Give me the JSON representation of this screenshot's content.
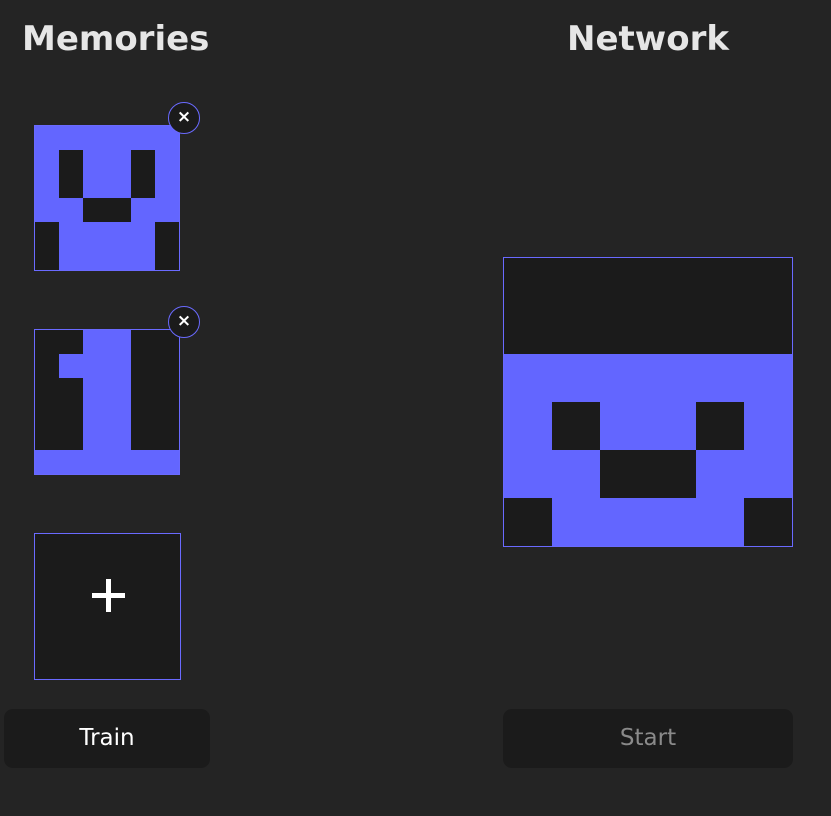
{
  "memories": {
    "title": "Memories",
    "items": [
      {
        "cells": [
          [
            1,
            1,
            1,
            1,
            1,
            1
          ],
          [
            1,
            0,
            1,
            1,
            0,
            1
          ],
          [
            1,
            0,
            1,
            1,
            0,
            1
          ],
          [
            1,
            1,
            0,
            0,
            1,
            1
          ],
          [
            0,
            1,
            1,
            1,
            1,
            0
          ],
          [
            0,
            1,
            1,
            1,
            1,
            0
          ]
        ],
        "remove_label": "×"
      },
      {
        "cells": [
          [
            0,
            0,
            1,
            1,
            0,
            0
          ],
          [
            0,
            1,
            1,
            1,
            0,
            0
          ],
          [
            0,
            0,
            1,
            1,
            0,
            0
          ],
          [
            0,
            0,
            1,
            1,
            0,
            0
          ],
          [
            0,
            0,
            1,
            1,
            0,
            0
          ],
          [
            1,
            1,
            1,
            1,
            1,
            1
          ]
        ],
        "remove_label": "×"
      }
    ],
    "add_icon": "plus-icon"
  },
  "network": {
    "title": "Network",
    "cells": [
      [
        0,
        0,
        0,
        0,
        0,
        0
      ],
      [
        0,
        0,
        0,
        0,
        0,
        0
      ],
      [
        1,
        1,
        1,
        1,
        1,
        1
      ],
      [
        1,
        0,
        1,
        1,
        0,
        1
      ],
      [
        1,
        1,
        0,
        0,
        1,
        1
      ],
      [
        0,
        1,
        1,
        1,
        1,
        0
      ]
    ]
  },
  "buttons": {
    "train_label": "Train",
    "start_label": "Start"
  },
  "colors": {
    "background": "#242424",
    "cell_on": "#6366ff",
    "cell_off": "#1b1b1b",
    "accent_border": "#6a6aff",
    "button_background": "#1b1b1b",
    "disabled_text": "#8a8a8a"
  }
}
